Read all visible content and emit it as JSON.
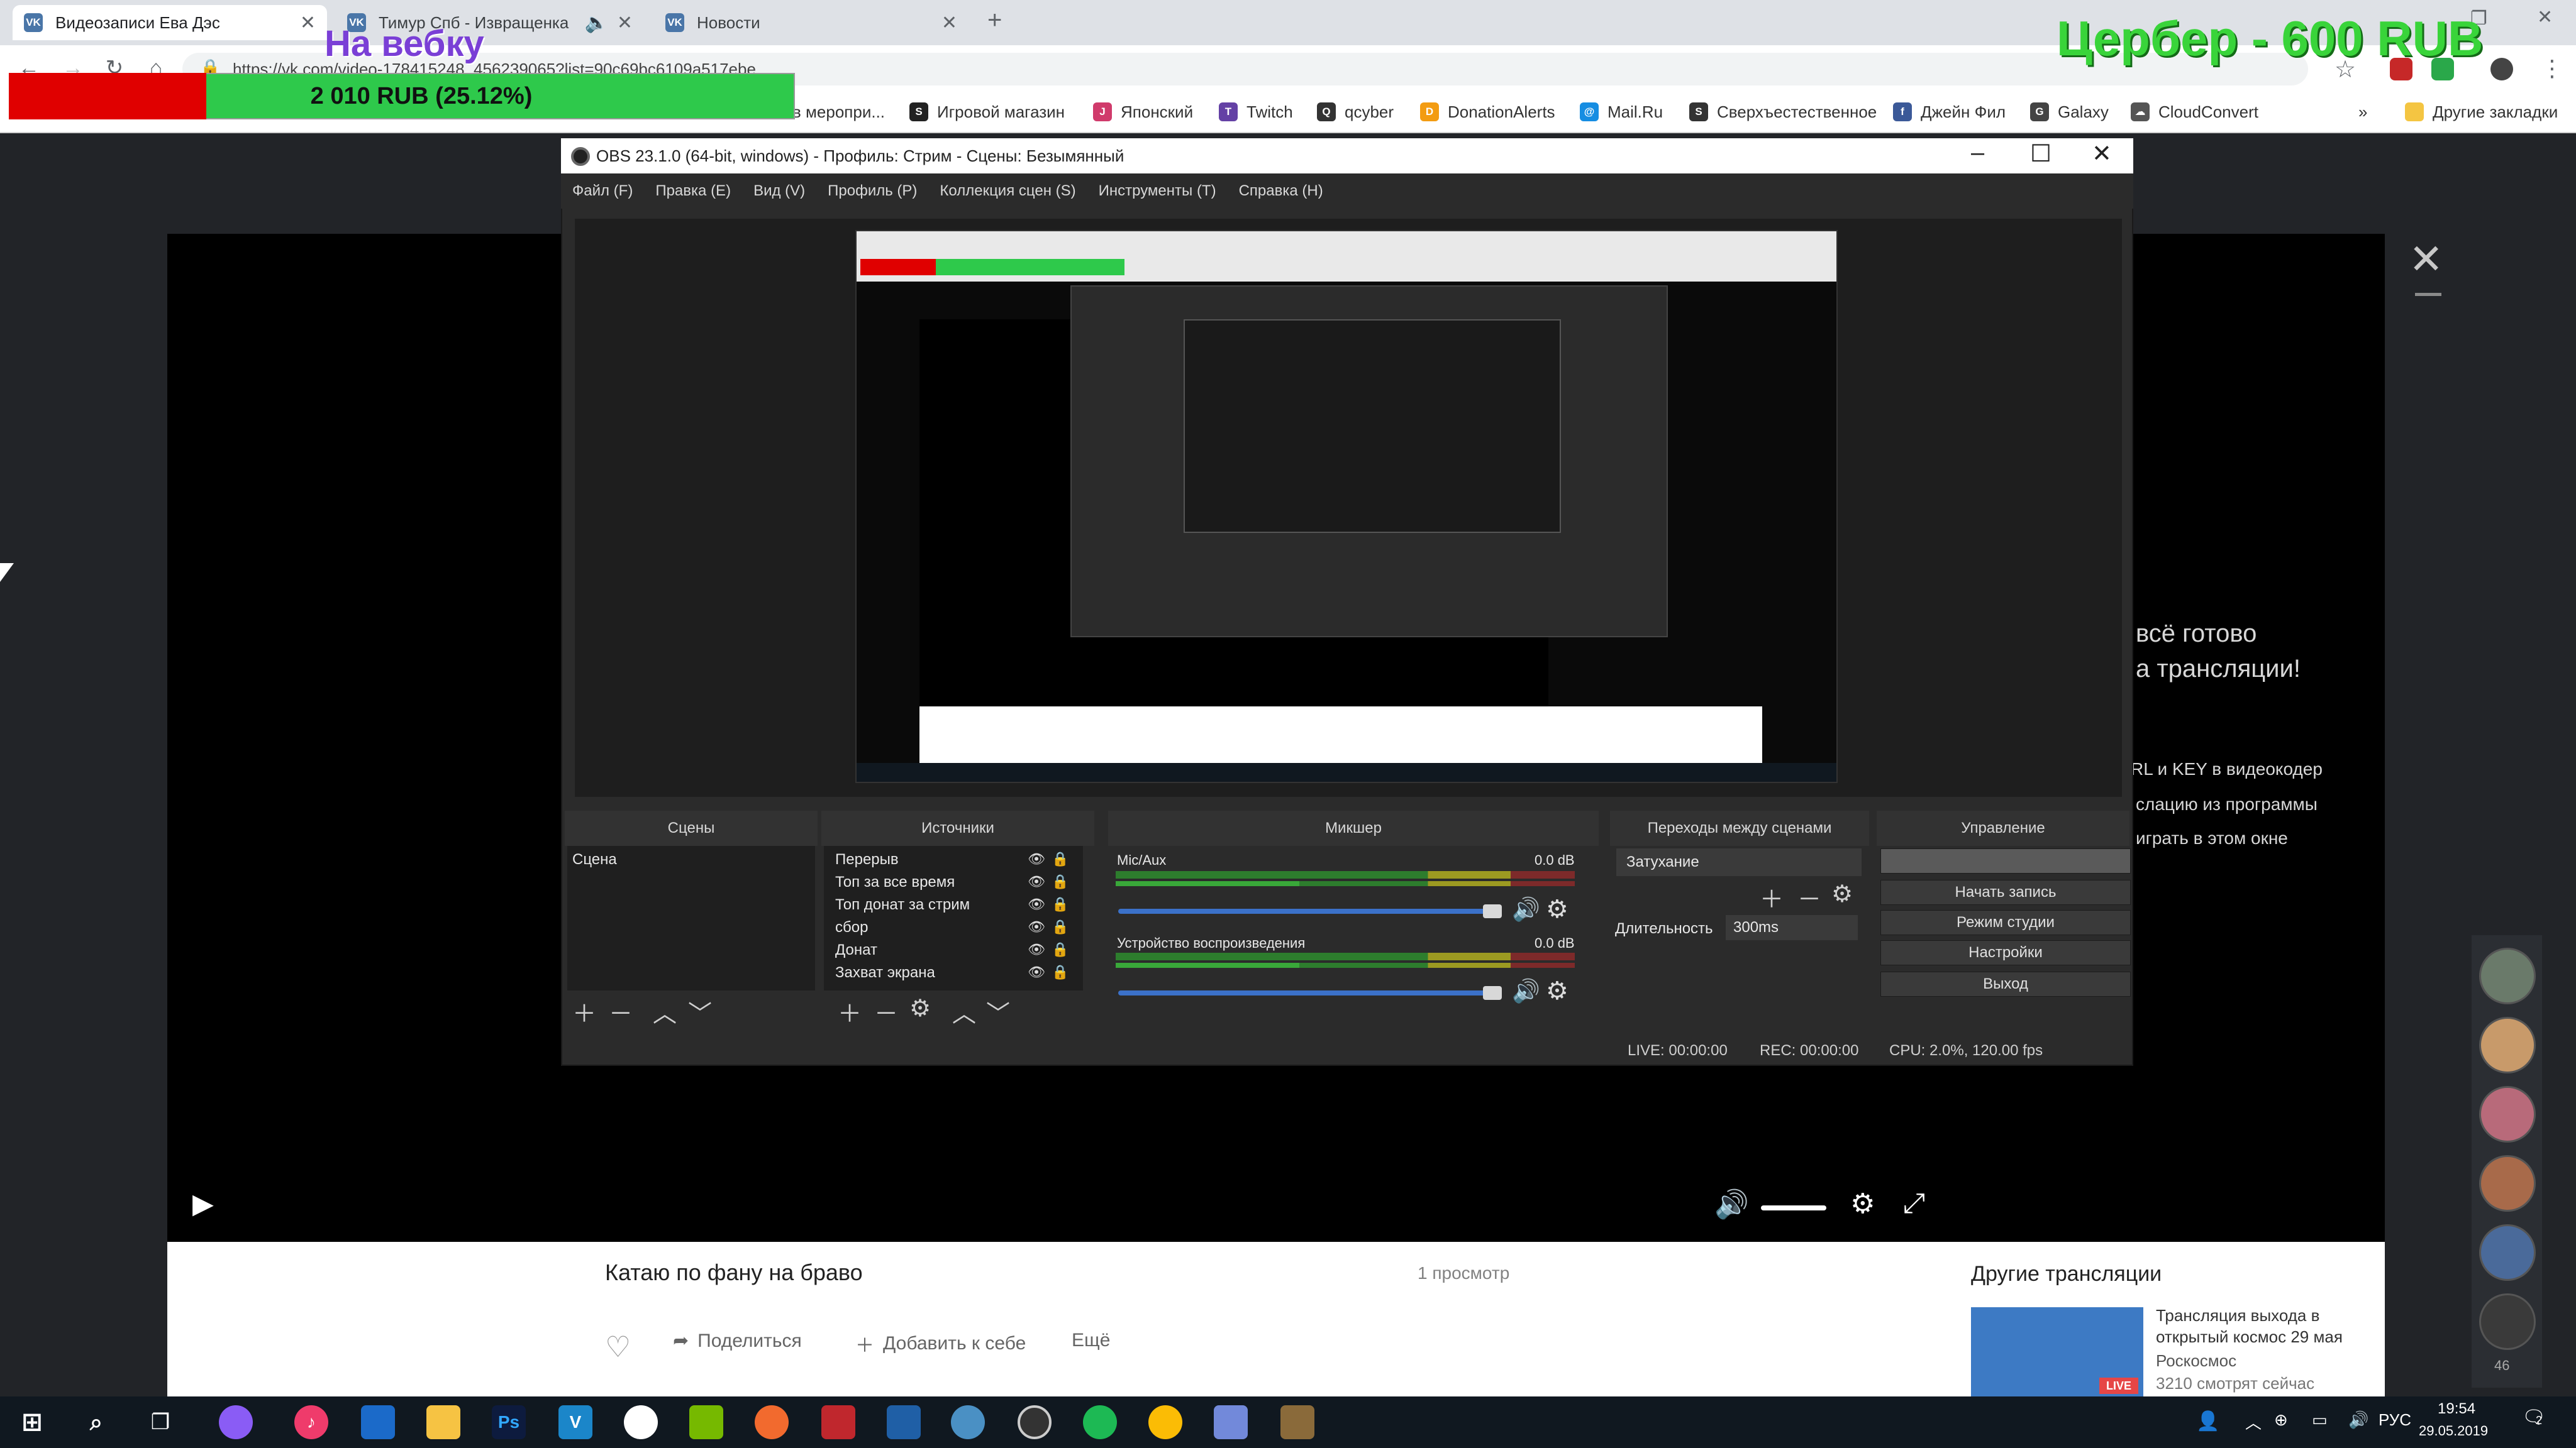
{
  "browser": {
    "tabs": [
      {
        "label": "Видеозаписи Ева Дэс",
        "active": true
      },
      {
        "label": "Тимур Спб - Извращенка",
        "active": false
      },
      {
        "label": "Новости",
        "active": false
      }
    ],
    "new_tab": "+",
    "url": "https://vk.com/video-178415248_456239065?list=90c69bc6109a517ebe",
    "bookmarks": [
      {
        "label": "в меропри...",
        "color": "#888888"
      },
      {
        "label": "Игровой магазин",
        "color": "#222222"
      },
      {
        "label": "Японский",
        "color": "#d03a6b"
      },
      {
        "label": "Twitch",
        "color": "#6441a5"
      },
      {
        "label": "qcyber",
        "color": "#333333"
      },
      {
        "label": "DonationAlerts",
        "color": "#f39c12"
      },
      {
        "label": "Mail.Ru",
        "color": "#168de2"
      },
      {
        "label": "Сверхъестественное",
        "color": "#333333"
      },
      {
        "label": "Джейн Фил",
        "color": "#3b5998"
      },
      {
        "label": "Galaxy",
        "color": "#444444"
      },
      {
        "label": "CloudConvert",
        "color": "#555555"
      }
    ],
    "more_bookmarks": "»",
    "other_bookmarks": "Другие закладки"
  },
  "overlay": {
    "title": "На вебку",
    "donation_text": "2 010 RUB (25.12%)",
    "progress_fraction": 0.2512,
    "goal": "Цербер - 600 RUB"
  },
  "obs": {
    "title": "OBS 23.1.0 (64-bit, windows) - Профиль: Стрим - Сцены: Безымянный",
    "menu": [
      "Файл (F)",
      "Правка (E)",
      "Вид (V)",
      "Профиль (P)",
      "Коллекция сцен (S)",
      "Инструменты (T)",
      "Справка (H)"
    ],
    "docks": {
      "scenes": "Сцены",
      "sources": "Источники",
      "mixer": "Микшер",
      "transitions": "Переходы между сценами",
      "controls": "Управление"
    },
    "scenes": [
      "Сцена"
    ],
    "sources": [
      "Перерыв",
      "Топ за все время",
      "Топ донат за стрим",
      "сбор",
      "Донат",
      "Захват экрана"
    ],
    "mixer": [
      {
        "name": "Mic/Aux",
        "db": "0.0 dB"
      },
      {
        "name": "Устройство воспроизведения",
        "db": "0.0 dB"
      }
    ],
    "transition": {
      "name": "Затухание",
      "duration_label": "Длительность",
      "duration": "300ms"
    },
    "controls": [
      "Начать запись",
      "Режим студии",
      "Настройки",
      "Выход"
    ],
    "status": {
      "live": "LIVE: 00:00:00",
      "rec": "REC: 00:00:00",
      "cpu": "CPU: 2.0%, 120.00 fps"
    }
  },
  "vk": {
    "right_text": [
      "всё готово",
      "а трансляции!",
      "RL и KEY в видеокодер",
      "слацию из программы",
      "играть в этом окне"
    ],
    "video_title": "Катаю по фану на браво",
    "views": "1 просмотр",
    "actions": {
      "share": "Поделиться",
      "add": "Добавить к себе",
      "more": "Ещё"
    },
    "other_streams": "Другие трансляции",
    "other_stream": {
      "title1": "Трансляция выхода в",
      "title2": "открытый космос 29 мая",
      "channel": "Роскосмос",
      "watching": "3210 смотрят сейчас",
      "live": "LIVE"
    },
    "online_count": "46"
  },
  "taskbar": {
    "lang": "РУС",
    "time": "19:54",
    "date": "29.05.2019",
    "notif": "2"
  }
}
